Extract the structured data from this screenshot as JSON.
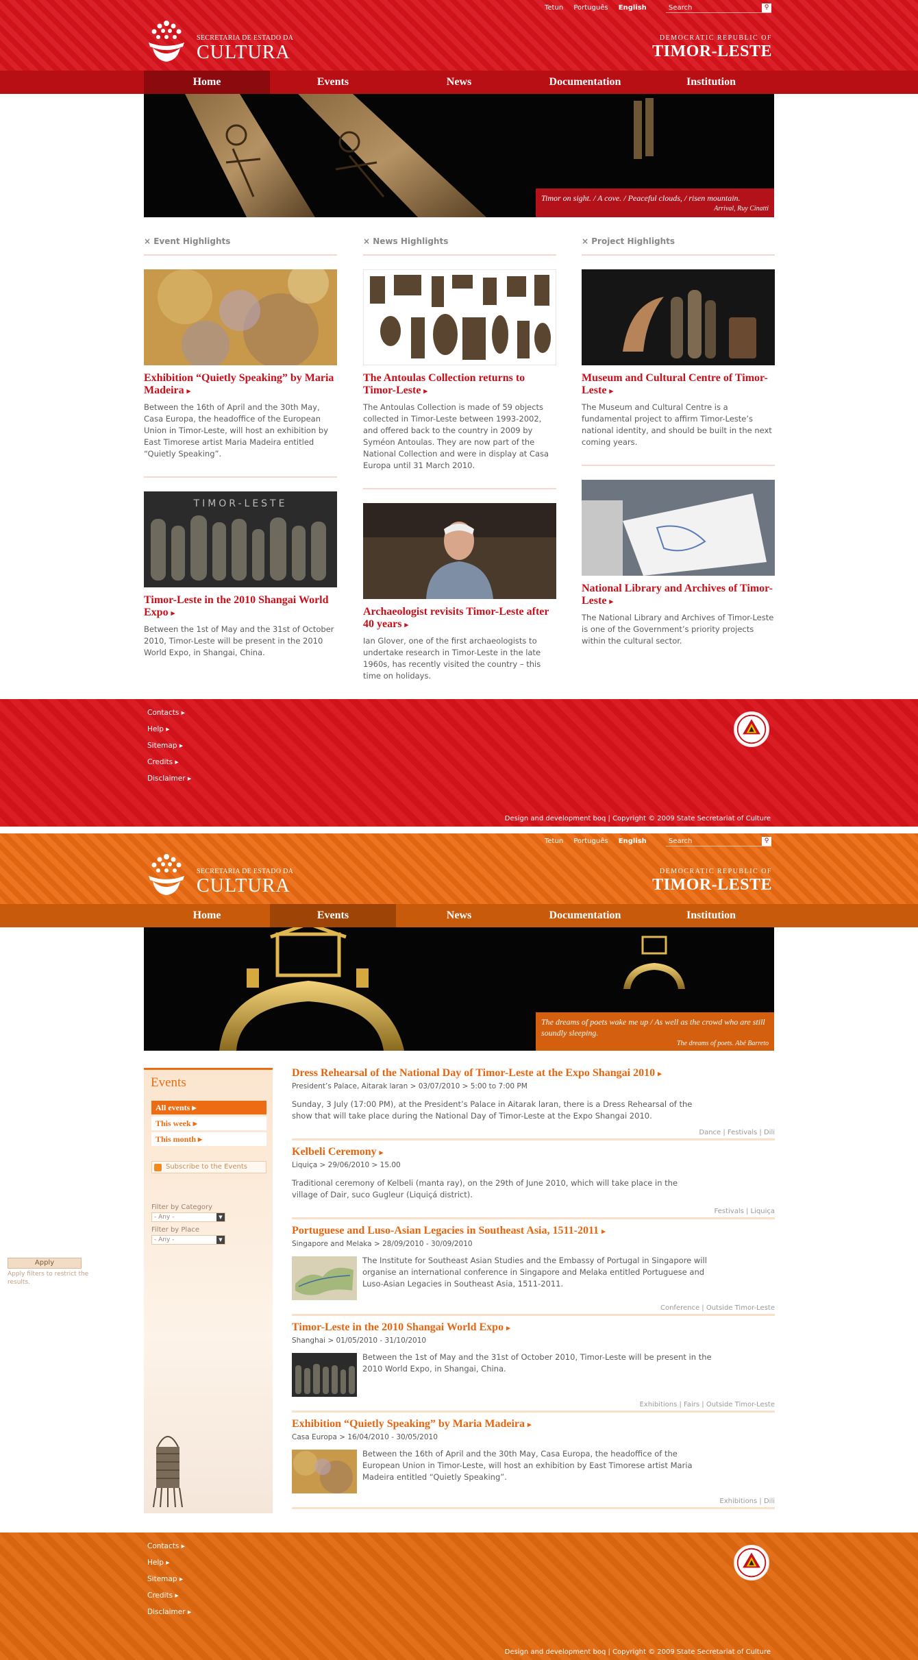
{
  "languages": [
    "Tetun",
    "Português",
    "English"
  ],
  "active_language": "English",
  "search_placeholder": "Search",
  "logo": {
    "small": "SECRETARIA DE ESTADO DA",
    "big": "CULTURA"
  },
  "country": {
    "line1": "DEMOCRATIC REPUBLIC OF",
    "line2": "TIMOR-LESTE"
  },
  "nav": [
    "Home",
    "Events",
    "News",
    "Documentation",
    "Institution"
  ],
  "home": {
    "active_tab": "Home",
    "banner": {
      "quote": "Timor on sight. / A cove. / Peaceful clouds, / risen mountain.",
      "attribution": "Arrival, Ruy Cinatti"
    },
    "columns": [
      {
        "heading": "Event Highlights",
        "cards": [
          {
            "title": "Exhibition “Quietly Speaking” by Maria Madeira",
            "text": "Between the 16th of April and the 30th May, Casa Europa, the headoffice of the European Union in Timor-Leste, will host an exhibition by East Timorese artist Maria Madeira entitled “Quietly Speaking”."
          },
          {
            "title": "Timor-Leste in the 2010 Shangai World Expo",
            "text": "Between the 1st of May and the 31st of October 2010, Timor-Leste will be present in the 2010 World Expo, in Shangai, China."
          }
        ]
      },
      {
        "heading": "News Highlights",
        "cards": [
          {
            "title": "The Antoulas Collection returns to Timor-Leste",
            "text": "The Antoulas Collection is made of 59 objects collected in Timor-Leste between 1993-2002, and offered back to the country in 2009 by Syméon Antoulas. They are now part of the National Collection and were in display at Casa Europa until 31 March 2010."
          },
          {
            "title": "Archaeologist revisits Timor-Leste after 40 years",
            "text": "Ian Glover, one of the first archaeologists to undertake research in Timor-Leste in the late 1960s, has recently visited the country – this time on holidays."
          }
        ]
      },
      {
        "heading": "Project Highlights",
        "cards": [
          {
            "title": "Museum and Cultural Centre of Timor-Leste",
            "text": "The Museum and Cultural Centre is a fundamental project to affirm Timor-Leste’s national identity, and should be built in the next coming years."
          },
          {
            "title": "National Library and Archives of Timor-Leste",
            "text": "The National Library and Archives of Timor-Leste is one of the Government’s priority projects within the cultural sector."
          }
        ]
      }
    ]
  },
  "events_page": {
    "active_tab": "Events",
    "banner": {
      "quote": "The dreams of poets wake me up / As well as the crowd who are still soundly sleeping.",
      "attribution": "The dreams of poets. Abé Barreto"
    },
    "sidebar": {
      "title": "Events",
      "menu": [
        "All events",
        "This week",
        "This month"
      ],
      "rss": "Subscribe to the Events",
      "filter_category": "Filter by Category",
      "filter_place": "Filter by Place",
      "any": "- Any -",
      "apply": "Apply",
      "apply_note": "Apply filters to restrict the results."
    },
    "events": [
      {
        "title": "Dress Rehearsal of the National Day of Timor-Leste at the Expo Shangai 2010",
        "meta": "President’s Palace, Aitarak laran > 03/07/2010 > 5:00 to 7:00 PM",
        "desc": "Sunday, 3 July (17:00 PM), at the President’s Palace in Aitarak laran, there is a Dress Rehearsal of the show that will take place during the National Day of Timor-Leste at the Expo Shangai 2010.",
        "tags": "Dance | Festivals | Dili"
      },
      {
        "title": "Kelbeli Ceremony",
        "meta": "Liquiça > 29/06/2010 > 15.00",
        "desc": "Traditional ceremony of Kelbeli (manta ray), on the 29th of June 2010, which will take place in the village of Dair, suco Gugleur (Liquiçá district).",
        "tags": "Festivals | Liquiça"
      },
      {
        "title": "Portuguese and Luso-Asian Legacies in Southeast Asia, 1511-2011",
        "meta": "Singapore and Melaka > 28/09/2010 - 30/09/2010",
        "desc": "The Institute for Southeast Asian Studies and the Embassy of Portugal in Singapore will organise an international conference in Singapore and Melaka entitled Portuguese and Luso-Asian Legacies in Southeast Asia, 1511-2011.",
        "tags": "Conference | Outside Timor-Leste"
      },
      {
        "title": "Timor-Leste in the 2010 Shangai World Expo",
        "meta": "Shanghai > 01/05/2010 - 31/10/2010",
        "desc": "Between the 1st of May and the 31st of October 2010, Timor-Leste will be present in the 2010 World Expo, in Shangai, China.",
        "tags": "Exhibitions | Fairs | Outside Timor-Leste"
      },
      {
        "title": "Exhibition “Quietly Speaking” by Maria Madeira",
        "meta": "Casa Europa > 16/04/2010 - 30/05/2010",
        "desc": "Between the 16th of April and the 30th May, Casa Europa, the headoffice of the European Union in Timor-Leste, will host an exhibition by East Timorese artist Maria Madeira entitled “Quietly Speaking”.",
        "tags": "Exhibitions | Dili"
      }
    ]
  },
  "footer": {
    "links": [
      "Contacts",
      "Help",
      "Sitemap",
      "Credits",
      "Disclaimer"
    ],
    "copyright": "Design and development boq  |  Copyright © 2009 State Secretariat of Culture"
  },
  "colors": {
    "red": "#d8141c",
    "orange": "#ec6c13"
  }
}
